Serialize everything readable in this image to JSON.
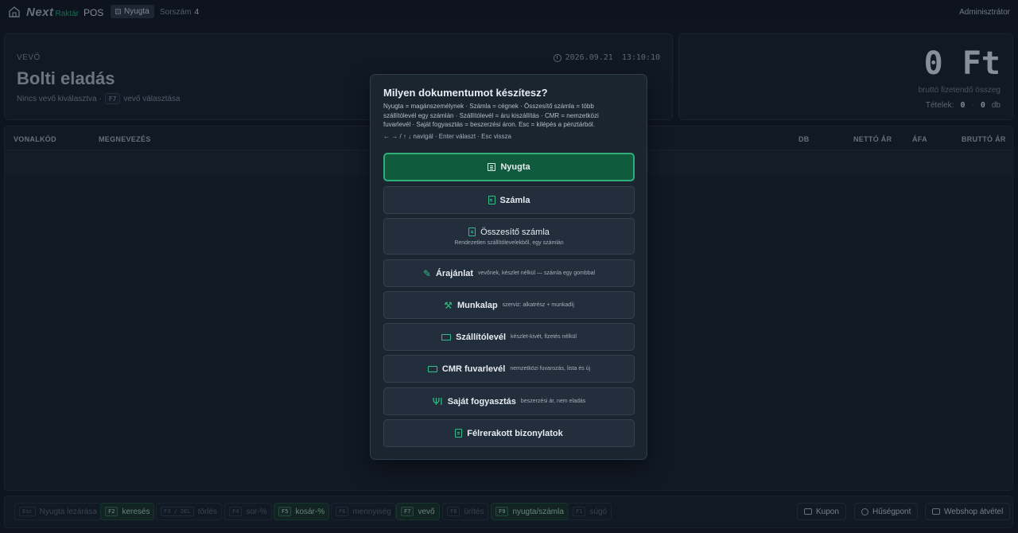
{
  "topbar": {
    "logo_next": "Next",
    "logo_raktar": "Raktár",
    "logo_pos": "POS",
    "doc_chip": "Nyugta",
    "sorszam_label": "Sorszám",
    "sorszam_value": "4",
    "user": "Adminisztrátor"
  },
  "customer": {
    "label": "VEVŐ",
    "name": "Bolti eladás",
    "none_text": "Nincs vevő kiválasztva ·",
    "key": "F7",
    "select_text": "vevő választása",
    "date": "2026.09.21",
    "time": "13:10:10"
  },
  "total": {
    "amount": "0 Ft",
    "caption": "bruttó fizetendő összeg",
    "items_label": "Tételek:",
    "items_count": "0",
    "sep": "·",
    "qty": "0",
    "unit": "db"
  },
  "table": {
    "columns": [
      "VONALKÓD",
      "MEGNEVEZÉS",
      "DB",
      "NETTÓ ÁR",
      "ÁFA",
      "BRUTTÓ ÁR"
    ]
  },
  "footer": {
    "keys": [
      {
        "key": "Esc",
        "label": "Nyugta lezárása"
      },
      {
        "key": "F2",
        "label": "keresés"
      },
      {
        "key": "F3 / DEL",
        "label": "törlés"
      },
      {
        "key": "F4",
        "label": "sor-%"
      },
      {
        "key": "F5",
        "label": "kosár-%"
      },
      {
        "key": "F6",
        "label": "mennyiség"
      },
      {
        "key": "F7",
        "label": "vevő"
      },
      {
        "key": "F8",
        "label": "ürítés"
      },
      {
        "key": "F9",
        "label": "nyugta/számla"
      },
      {
        "key": "F1",
        "label": "súgó"
      }
    ],
    "kupon": "Kupon",
    "huseg": "Hűségpont",
    "webshop": "Webshop átvétel"
  },
  "modal": {
    "title": "Milyen dokumentumot készítesz?",
    "description": "Nyugta = magánszemélynek · Számla = cégnek · Összesítő számla = több szállítólevél egy számlán · Szállítólevél = áru kiszállítás · CMR = nemzetközi fuvarlevél · Saját fogyasztás = beszerzési áron. Esc = kilépés a pénztárból.",
    "nav_hint": "← → / ↑ ↓ navigál · Enter választ · Esc vissza",
    "options": [
      {
        "label": "Nyugta",
        "note": "",
        "icon": "receipt-icon"
      },
      {
        "label": "Számla",
        "note": "",
        "icon": "invoice-icon"
      },
      {
        "label": "Összesítő számla",
        "note": "Rendezetlen szállítólevelekből, egy számlán",
        "icon": "summary-invoice-icon"
      },
      {
        "label": "Árajánlat",
        "note": "vevőnek, készlet nélkül — számla egy gombbal",
        "icon": "quote-icon"
      },
      {
        "label": "Munkalap",
        "note": "szerviz: alkatrész + munkadíj",
        "icon": "wrench-icon"
      },
      {
        "label": "Szállítólevél",
        "note": "készlet-kivét, fizetés nélkül",
        "icon": "truck-icon"
      },
      {
        "label": "CMR fuvarlevél",
        "note": "nemzetközi fuvarozás, lista és új",
        "icon": "cmr-truck-icon"
      },
      {
        "label": "Saját fogyasztás",
        "note": "beszerzési ár, nem eladás",
        "icon": "fork-knife-icon"
      },
      {
        "label": "Félrerakott bizonylatok",
        "note": "",
        "icon": "parked-document-icon"
      }
    ]
  }
}
